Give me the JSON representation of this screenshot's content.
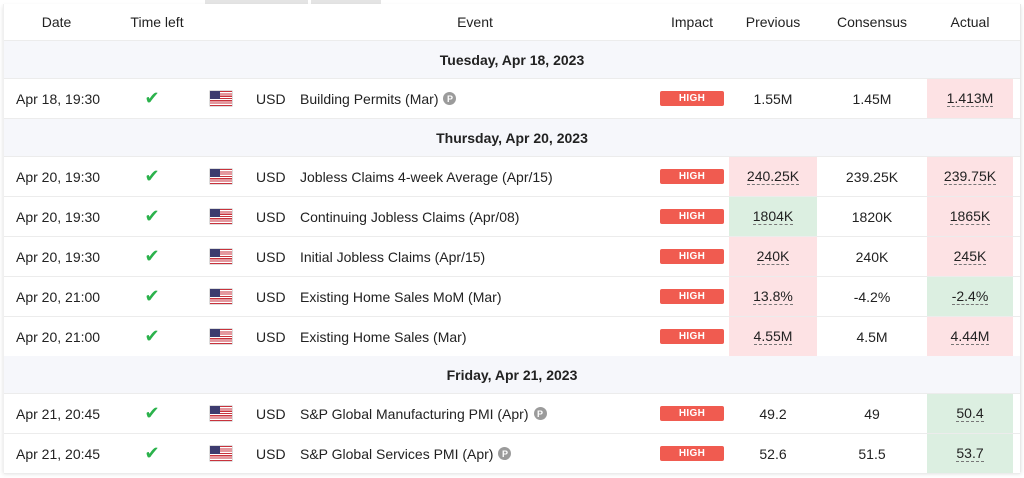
{
  "headers": {
    "date": "Date",
    "time_left": "Time left",
    "event": "Event",
    "impact": "Impact",
    "previous": "Previous",
    "consensus": "Consensus",
    "actual": "Actual"
  },
  "groups": [
    {
      "title": "Tuesday, Apr 18, 2023"
    },
    {
      "title": "Thursday, Apr 20, 2023"
    },
    {
      "title": "Friday, Apr 21, 2023"
    }
  ],
  "rows": [
    {
      "date": "Apr 18, 19:30",
      "time_left": "✔",
      "currency": "USD",
      "event": "Building Permits (Mar)",
      "preliminary": "P",
      "impact": "HIGH",
      "previous": "1.55M",
      "consensus": "1.45M",
      "actual": "1.413M",
      "previous_highlight": "none",
      "actual_highlight": "red"
    },
    {
      "date": "Apr 20, 19:30",
      "time_left": "✔",
      "currency": "USD",
      "event": "Jobless Claims 4-week Average (Apr/15)",
      "preliminary": "",
      "impact": "HIGH",
      "previous": "240.25K",
      "consensus": "239.25K",
      "actual": "239.75K",
      "previous_highlight": "red",
      "actual_highlight": "red"
    },
    {
      "date": "Apr 20, 19:30",
      "time_left": "✔",
      "currency": "USD",
      "event": "Continuing Jobless Claims (Apr/08)",
      "preliminary": "",
      "impact": "HIGH",
      "previous": "1804K",
      "consensus": "1820K",
      "actual": "1865K",
      "previous_highlight": "green",
      "actual_highlight": "red"
    },
    {
      "date": "Apr 20, 19:30",
      "time_left": "✔",
      "currency": "USD",
      "event": "Initial Jobless Claims (Apr/15)",
      "preliminary": "",
      "impact": "HIGH",
      "previous": "240K",
      "consensus": "240K",
      "actual": "245K",
      "previous_highlight": "red",
      "actual_highlight": "red"
    },
    {
      "date": "Apr 20, 21:00",
      "time_left": "✔",
      "currency": "USD",
      "event": "Existing Home Sales MoM (Mar)",
      "preliminary": "",
      "impact": "HIGH",
      "previous": "13.8%",
      "consensus": "-4.2%",
      "actual": "-2.4%",
      "previous_highlight": "red",
      "actual_highlight": "green"
    },
    {
      "date": "Apr 20, 21:00",
      "time_left": "✔",
      "currency": "USD",
      "event": "Existing Home Sales (Mar)",
      "preliminary": "",
      "impact": "HIGH",
      "previous": "4.55M",
      "consensus": "4.5M",
      "actual": "4.44M",
      "previous_highlight": "red",
      "actual_highlight": "red"
    },
    {
      "date": "Apr 21, 20:45",
      "time_left": "✔",
      "currency": "USD",
      "event": "S&P Global Manufacturing PMI (Apr)",
      "preliminary": "P",
      "impact": "HIGH",
      "previous": "49.2",
      "consensus": "49",
      "actual": "50.4",
      "previous_highlight": "none",
      "actual_highlight": "green"
    },
    {
      "date": "Apr 21, 20:45",
      "time_left": "✔",
      "currency": "USD",
      "event": "S&P Global Services PMI (Apr)",
      "preliminary": "P",
      "impact": "HIGH",
      "previous": "52.6",
      "consensus": "51.5",
      "actual": "53.7",
      "previous_highlight": "none",
      "actual_highlight": "green"
    }
  ],
  "icons": {
    "country_flag": "us-flag-icon",
    "status": "checkmark-icon",
    "preliminary": "preliminary-p-icon"
  },
  "colors": {
    "high_impact": "#f05b50",
    "worse_highlight": "#fde2e4",
    "better_highlight": "#dcefe1",
    "check_green": "#2bb24c"
  }
}
